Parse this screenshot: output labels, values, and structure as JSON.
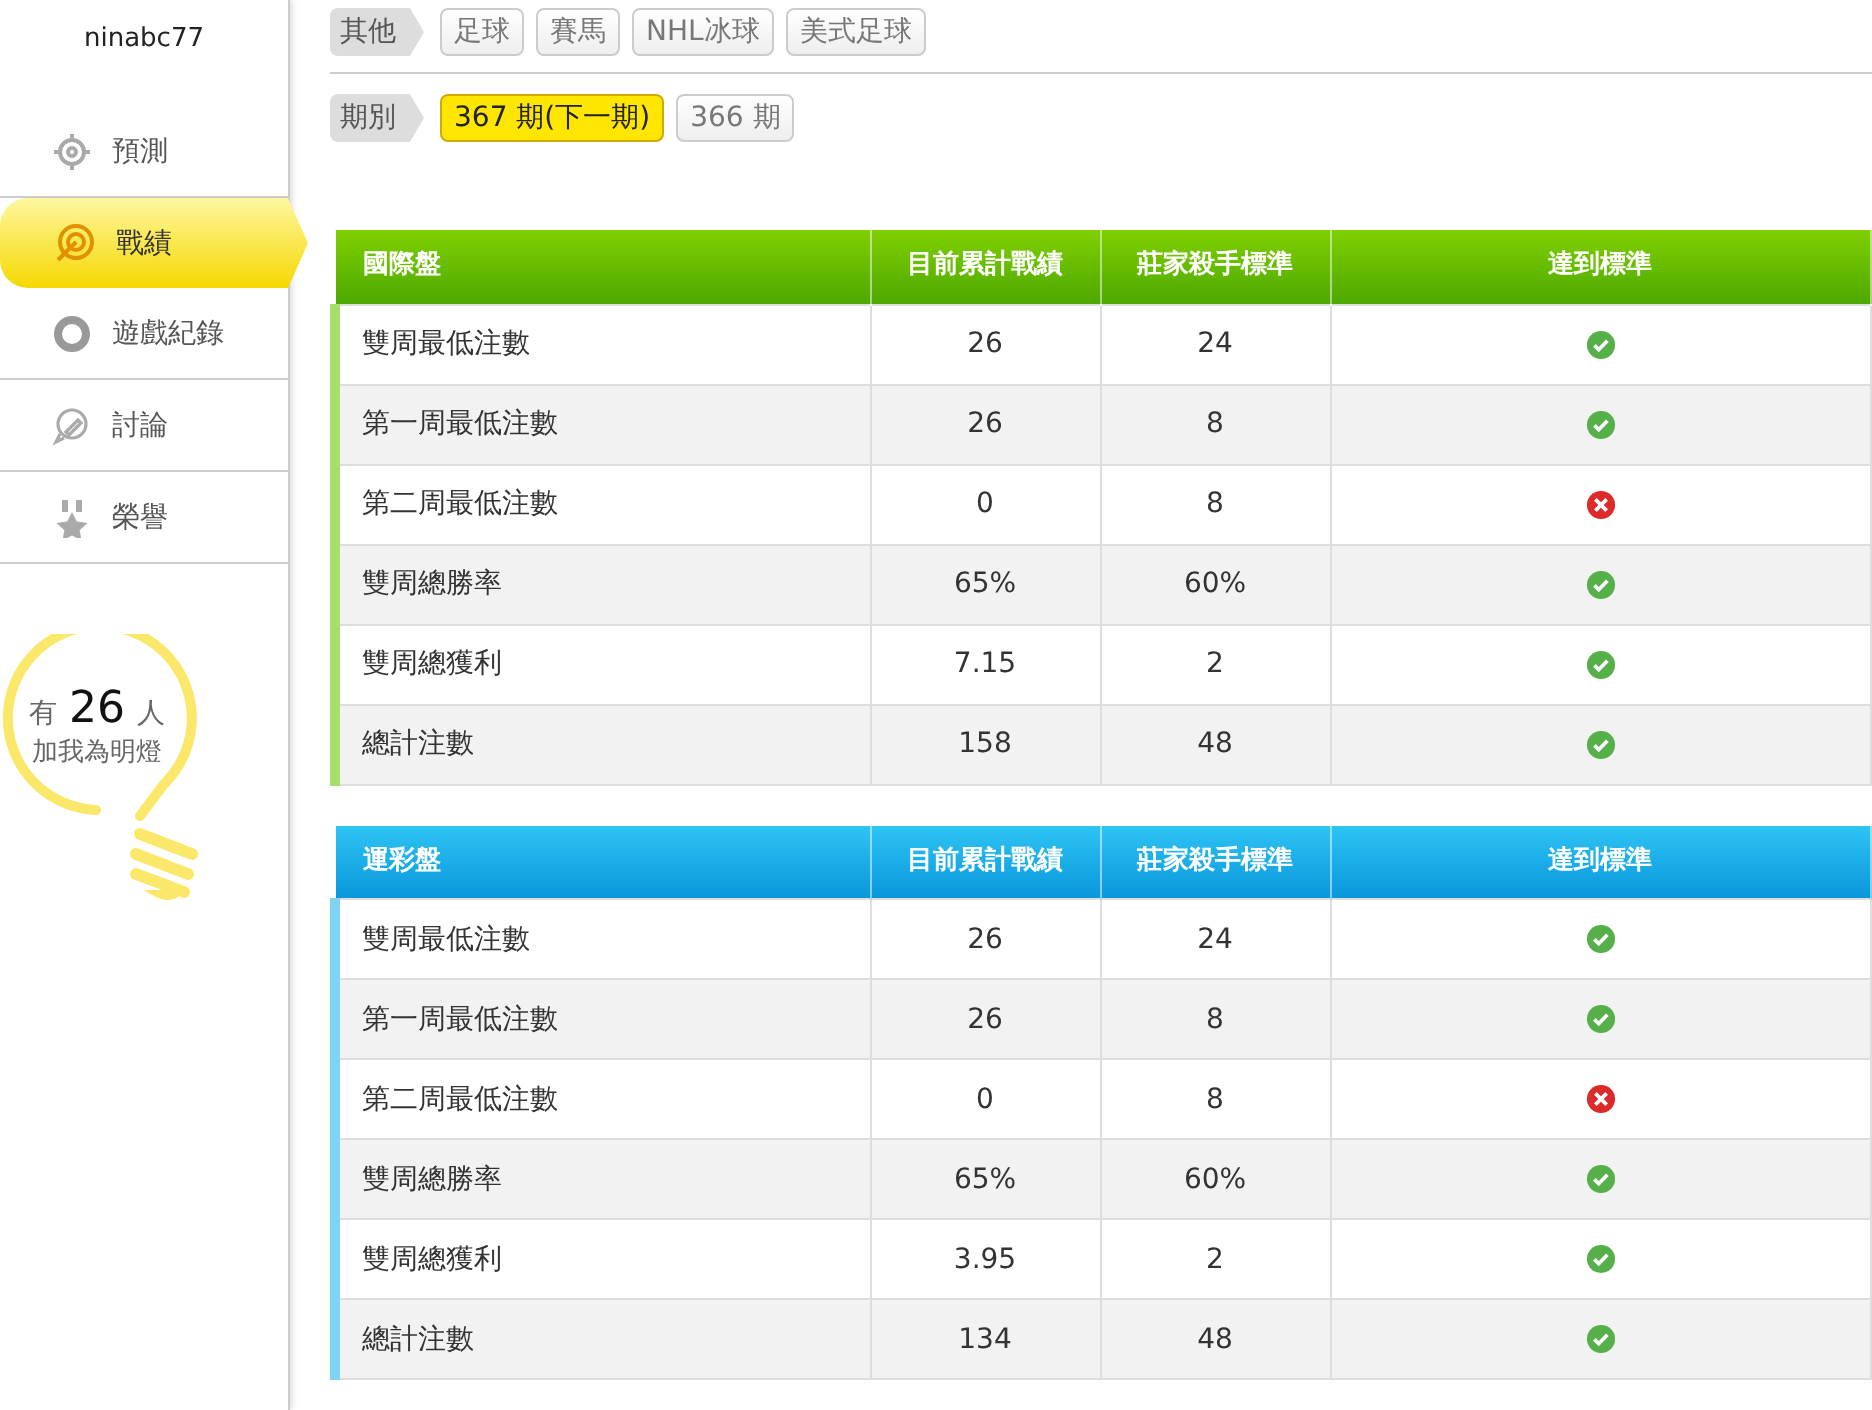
{
  "sidebar": {
    "username": "ninabc77",
    "items": [
      {
        "label": "預測",
        "selected": false
      },
      {
        "label": "戰績",
        "selected": true
      },
      {
        "label": "遊戲紀錄",
        "selected": false
      },
      {
        "label": "討論",
        "selected": false
      },
      {
        "label": "榮譽",
        "selected": false
      }
    ],
    "fans": {
      "prefix": "有",
      "count": "26",
      "suffix": "人",
      "caption": "加我為明燈"
    }
  },
  "filters": [
    {
      "label": "其他",
      "options": [
        {
          "label": "足球",
          "selected": false
        },
        {
          "label": "賽馬",
          "selected": false
        },
        {
          "label": "NHL冰球",
          "selected": false
        },
        {
          "label": "美式足球",
          "selected": false
        }
      ]
    },
    {
      "label": "期別",
      "options": [
        {
          "label": "367 期(下一期)",
          "selected": true
        },
        {
          "label": "366 期",
          "selected": false
        }
      ]
    }
  ],
  "tables": [
    {
      "columns": [
        "國際盤",
        "目前累計戰績",
        "莊家殺手標準",
        "達到標準"
      ],
      "rows": [
        {
          "name": "雙周最低注數",
          "current": "26",
          "standard": "24",
          "met": true
        },
        {
          "name": "第一周最低注數",
          "current": "26",
          "standard": "8",
          "met": true
        },
        {
          "name": "第二周最低注數",
          "current": "0",
          "standard": "8",
          "met": false
        },
        {
          "name": "雙周總勝率",
          "current": "65%",
          "standard": "60%",
          "met": true
        },
        {
          "name": "雙周總獲利",
          "current": "7.15",
          "standard": "2",
          "met": true
        },
        {
          "name": "總計注數",
          "current": "158",
          "standard": "48",
          "met": true
        }
      ]
    },
    {
      "columns": [
        "運彩盤",
        "目前累計戰績",
        "莊家殺手標準",
        "達到標準"
      ],
      "rows": [
        {
          "name": "雙周最低注數",
          "current": "26",
          "standard": "24",
          "met": true
        },
        {
          "name": "第一周最低注數",
          "current": "26",
          "standard": "8",
          "met": true
        },
        {
          "name": "第二周最低注數",
          "current": "0",
          "standard": "8",
          "met": false
        },
        {
          "name": "雙周總勝率",
          "current": "65%",
          "standard": "60%",
          "met": true
        },
        {
          "name": "雙周總獲利",
          "current": "3.95",
          "standard": "2",
          "met": true
        },
        {
          "name": "總計注數",
          "current": "134",
          "standard": "48",
          "met": true
        }
      ]
    }
  ]
}
